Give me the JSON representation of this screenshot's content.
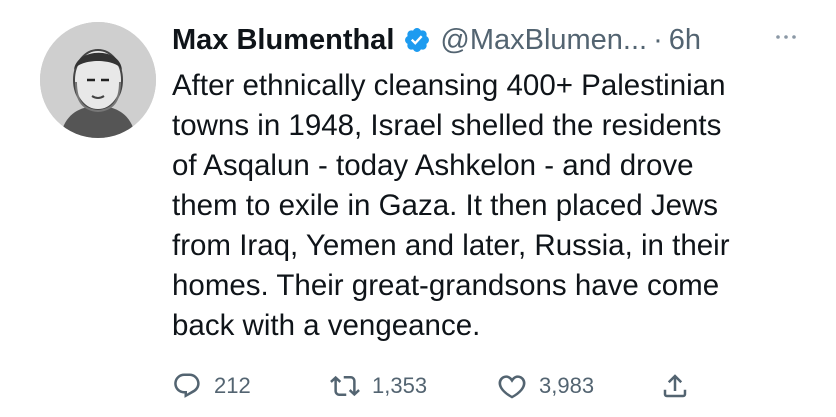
{
  "author": {
    "display_name": "Max Blumenthal",
    "handle": "@MaxBlumen...",
    "separator": "·",
    "time": "6h",
    "verified": true
  },
  "tweet": {
    "lines": [
      "After ethnically cleansing 400+ Palestinian",
      "towns in 1948, Israel shelled the residents",
      "of Asqalun - today Ashkelon - and drove",
      "them to exile in Gaza. It then placed Jews",
      "from Iraq, Yemen and later, Russia, in their",
      "homes. Their great-grandsons have come",
      "back with a vengeance."
    ]
  },
  "actions": {
    "reply": {
      "icon": "reply-icon",
      "count": "212"
    },
    "retweet": {
      "icon": "retweet-icon",
      "count": "1,353"
    },
    "like": {
      "icon": "heart-icon",
      "count": "3,983"
    },
    "share": {
      "icon": "share-icon"
    }
  },
  "colors": {
    "text": "#0f1419",
    "secondary": "#536471",
    "verified": "#1d9bf0"
  }
}
